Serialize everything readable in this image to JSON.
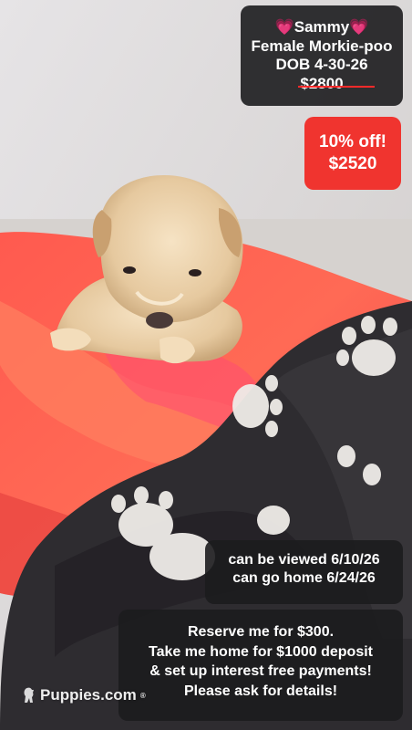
{
  "photo": {
    "subject": "cream puppy on coral fleece and dark paw-print blanket"
  },
  "name_card": {
    "name": "Sammy",
    "heart_icon": "pink-heart-icon",
    "breed": "Female Morkie-poo",
    "dob": "DOB 4-30-26",
    "original_price": "$2800"
  },
  "discount_card": {
    "label": "10% off!",
    "price": "$2520",
    "color": "#f0342f"
  },
  "dates_card": {
    "viewing": "can be viewed 6/10/26",
    "go_home": "can go home 6/24/26"
  },
  "reserve_card": {
    "line1": "Reserve me for $300.",
    "line2": "Take me home for $1000 deposit",
    "line3": "& set up interest free payments!",
    "line4": "Please ask for details!"
  },
  "watermark": {
    "text": "Puppies.com",
    "reg": "®"
  }
}
